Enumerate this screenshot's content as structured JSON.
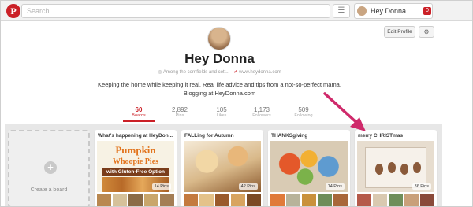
{
  "topbar": {
    "logo_letter": "P",
    "search_placeholder": "Search",
    "menu_icon": "hamburger-icon",
    "user_name": "Hey Donna",
    "notification_count": "0"
  },
  "profile": {
    "name": "Hey Donna",
    "location": "Among the cornfields and cott...",
    "website": "www.heydonna.com",
    "bio_line1": "Keeping the home while keeping it real. Real life advice and tips from a not-so-perfect mama.",
    "bio_line2": "Blogging at HeyDonna.com",
    "edit_label": "Edit Profile",
    "gear_icon": "gear-icon"
  },
  "stats": [
    {
      "num": "60",
      "label": "Boards"
    },
    {
      "num": "2,892",
      "label": "Pins"
    },
    {
      "num": "105",
      "label": "Likes"
    },
    {
      "num": "1,173",
      "label": "Followers"
    },
    {
      "num": "509",
      "label": "Following"
    }
  ],
  "create_board": {
    "label": "Create a board",
    "icon": "plus-icon"
  },
  "boards": [
    {
      "title": "What's happening at HeyDon...",
      "pins": "14 Pins",
      "cover_text1": "Pumpkin",
      "cover_text2": "Whoopie Pies",
      "cover_text3": "with Gluten-Free Option"
    },
    {
      "title": "FALLing for Autumn",
      "pins": "42 Pins"
    },
    {
      "title": "THANKSgiving",
      "pins": "14 Pins"
    },
    {
      "title": "merry CHRISTmas",
      "pins": "36 Pins"
    }
  ],
  "colors": {
    "brand_red": "#cb2027",
    "annotation": "#cf2a6b"
  }
}
